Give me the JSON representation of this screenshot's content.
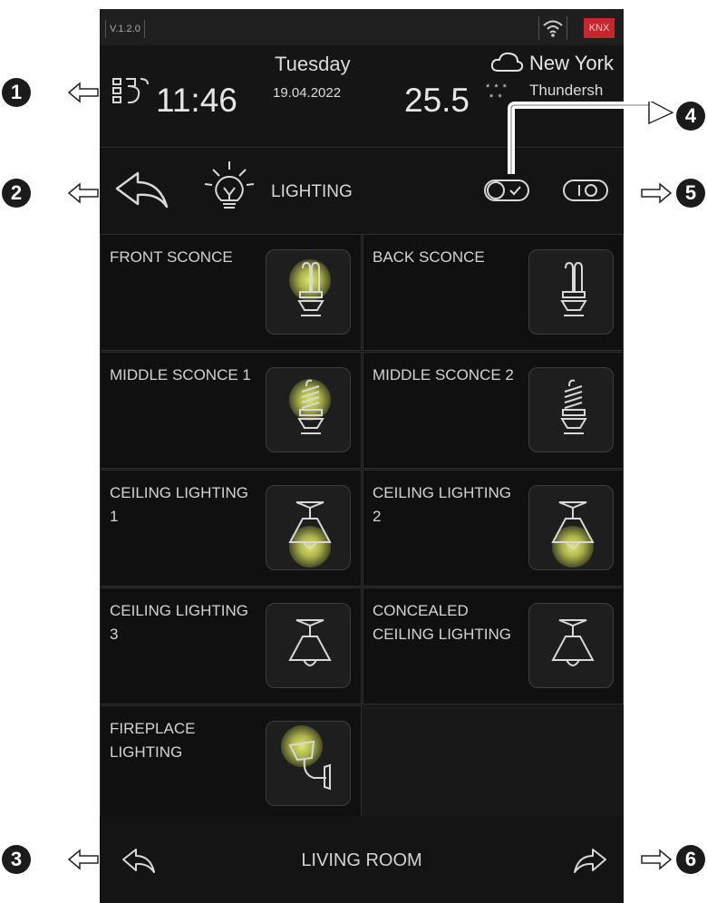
{
  "status_bar": {
    "version": "V.1.2.0",
    "knx_label": "KNX",
    "wifi_icon": "wifi-icon"
  },
  "header": {
    "time": "11:46",
    "day": "Tuesday",
    "date": "19.04.2022",
    "temperature": "25.5",
    "city": "New York",
    "weather": "Thundersh"
  },
  "title_bar": {
    "title": "LIGHTING"
  },
  "tiles": [
    {
      "label": "FRONT SCONCE",
      "icon": "cfl-bulb-icon",
      "on": true
    },
    {
      "label": "BACK SCONCE",
      "icon": "cfl-bulb-icon",
      "on": false
    },
    {
      "label": "MIDDLE SCONCE 1",
      "icon": "spiral-bulb-icon",
      "on": true
    },
    {
      "label": "MIDDLE SCONCE 2",
      "icon": "spiral-bulb-icon",
      "on": false
    },
    {
      "label": "CEILING LIGHTING 1",
      "icon": "ceiling-lamp-icon",
      "on": true
    },
    {
      "label": "CEILING LIGHTING 2",
      "icon": "ceiling-lamp-icon",
      "on": true
    },
    {
      "label": "CEILING LIGHTING 3",
      "icon": "ceiling-lamp-icon",
      "on": false
    },
    {
      "label": "CONCEALED CEILING LIGHTING",
      "icon": "ceiling-lamp-icon",
      "on": false
    },
    {
      "label": "FIREPLACE LIGHTING",
      "icon": "wall-lamp-icon",
      "on": true
    }
  ],
  "bottom_bar": {
    "room": "LIVING ROOM"
  },
  "callouts": [
    "1",
    "2",
    "3",
    "4",
    "5",
    "6"
  ],
  "colors": {
    "accent_glow": "#e6ef78",
    "knx_red": "#c6262e",
    "background": "#181818"
  }
}
